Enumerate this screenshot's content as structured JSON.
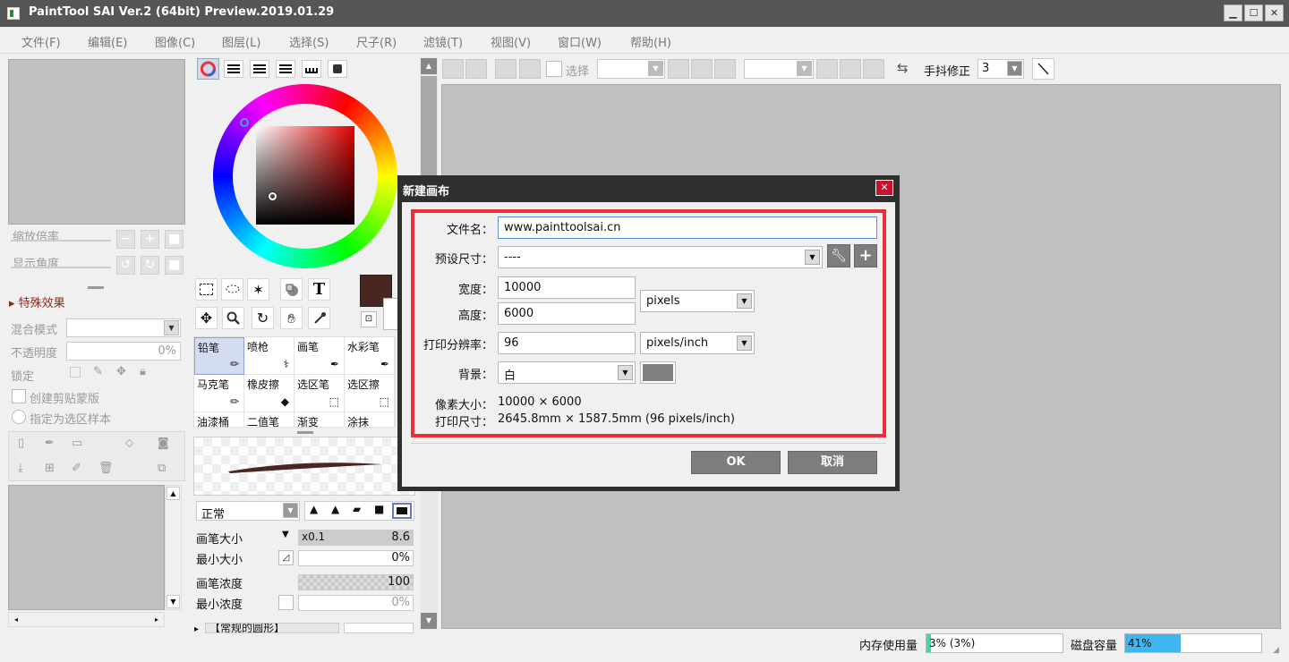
{
  "window": {
    "title": "PaintTool SAI Ver.2 (64bit) Preview.2019.01.29"
  },
  "menu": [
    "文件(F)",
    "编辑(E)",
    "图像(C)",
    "图层(L)",
    "选择(S)",
    "尺子(R)",
    "滤镜(T)",
    "视图(V)",
    "窗口(W)",
    "帮助(H)"
  ],
  "navigator": {
    "zoom_label": "缩放倍率",
    "rotate_label": "显示角度"
  },
  "layer_panel": {
    "effects_label": "特殊效果",
    "blend_label": "混合模式",
    "opacity_label": "不透明度",
    "opacity_value": "0%",
    "lock_label": "锁定",
    "clip_label": "创建剪贴蒙版",
    "sample_label": "指定为选区样本"
  },
  "color": {
    "primary": "#4a2620"
  },
  "brushes": [
    {
      "label": "铅笔"
    },
    {
      "label": "喷枪"
    },
    {
      "label": "画笔"
    },
    {
      "label": "水彩笔"
    },
    {
      "label": "马克笔"
    },
    {
      "label": "橡皮擦"
    },
    {
      "label": "选区笔"
    },
    {
      "label": "选区擦"
    },
    {
      "label": "油漆桶"
    },
    {
      "label": "二值笔"
    },
    {
      "label": "渐变"
    },
    {
      "label": "涂抹"
    }
  ],
  "brush_settings": {
    "mode": "正常",
    "size_label": "画笔大小",
    "size_multiplier": "x0.1",
    "size_value": "8.6",
    "min_size_label": "最小大小",
    "min_size_value": "0%",
    "density_label": "画笔浓度",
    "density_value": "100",
    "min_density_label": "最小浓度",
    "min_density_value": "0%",
    "shape_label": "【常规的圆形】"
  },
  "toolbar": {
    "select_label": "选择",
    "stabilizer_label": "手抖修正",
    "stabilizer_value": "3"
  },
  "dialog": {
    "title": "新建画布",
    "filename_label": "文件名：",
    "filename_value": "www.painttoolsai.cn",
    "preset_label": "预设尺寸：",
    "preset_value": "----",
    "width_label": "宽度：",
    "width_value": "10000",
    "height_label": "高度：",
    "height_value": "6000",
    "unit_value": "pixels",
    "dpi_label": "打印分辨率：",
    "dpi_value": "96",
    "dpi_unit": "pixels/inch",
    "bg_label": "背景：",
    "bg_value": "白",
    "bg_color": "#808080",
    "pixel_size_label": "像素大小：",
    "pixel_size_value": "10000 × 6000",
    "print_size_label": "打印尺寸：",
    "print_size_value": "2645.8mm × 1587.5mm (96 pixels/inch)",
    "ok_label": "OK",
    "cancel_label": "取消"
  },
  "status": {
    "memory_label": "内存使用量",
    "memory_text": "3% (3%)",
    "memory_percent": 3,
    "disk_label": "磁盘容量",
    "disk_text": "41%",
    "disk_percent": 41
  }
}
